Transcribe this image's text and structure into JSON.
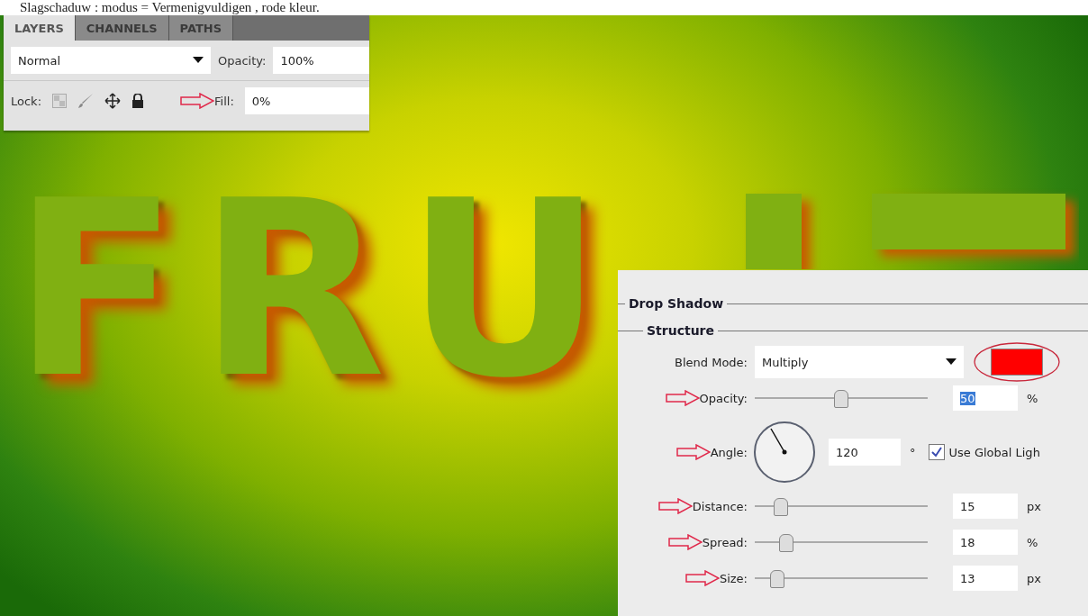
{
  "caption": "Slagschaduw : modus = Vermenigvuldigen , rode kleur.",
  "layers_panel": {
    "tabs": [
      {
        "label": "LAYERS",
        "selected": true
      },
      {
        "label": "CHANNELS",
        "selected": false
      },
      {
        "label": "PATHS",
        "selected": false
      }
    ],
    "blend_mode": "Normal",
    "opacity_label": "Opacity:",
    "opacity": "100%",
    "lock_label": "Lock:",
    "fill_label": "Fill:",
    "fill": "0%",
    "fill_arrow": true
  },
  "canvas": {
    "text": "FRU"
  },
  "dialog": {
    "title": "Drop Shadow",
    "section": "Structure",
    "blend_label": "Blend Mode:",
    "blend_mode": "Multiply",
    "color": "#ff0000",
    "color_circled": true,
    "rows": [
      {
        "kind": "slider",
        "label": "Opacity:",
        "level": 0.5,
        "value": "50",
        "value_selected": true,
        "unit": "%",
        "arrow": true
      },
      {
        "kind": "angle",
        "label": "Angle:",
        "value": "120",
        "unit": "°",
        "arrow": true,
        "checkbox": {
          "label": "Use Global Ligh",
          "checked": true
        }
      },
      {
        "kind": "slider",
        "label": "Distance:",
        "level": 0.15,
        "value": "15",
        "value_selected": false,
        "unit": "px",
        "arrow": true
      },
      {
        "kind": "slider",
        "label": "Spread:",
        "level": 0.18,
        "value": "18",
        "value_selected": false,
        "unit": "%",
        "arrow": true
      },
      {
        "kind": "slider",
        "label": "Size:",
        "level": 0.13,
        "value": "13",
        "value_selected": false,
        "unit": "px",
        "arrow": true
      }
    ]
  }
}
